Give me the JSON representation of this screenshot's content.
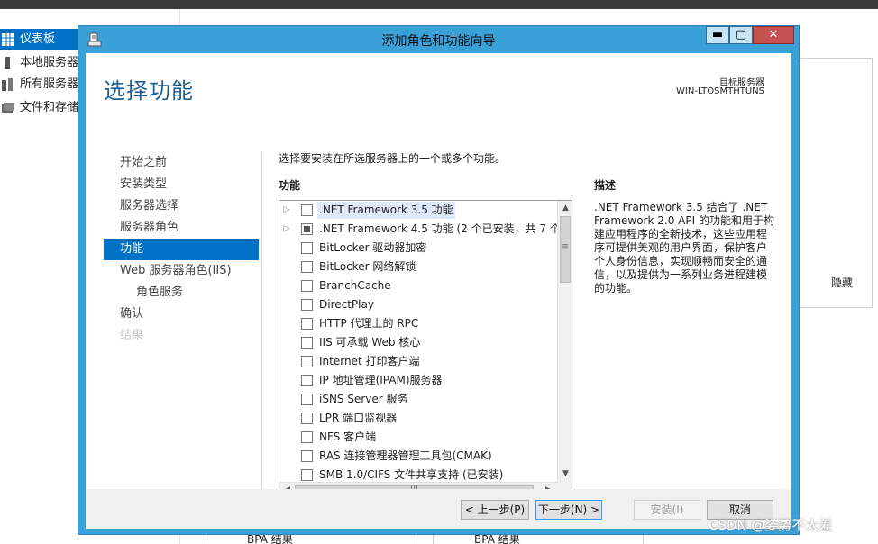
{
  "background": {
    "nav_items": [
      {
        "label": "仪表板",
        "active": true
      },
      {
        "label": "本地服务器"
      },
      {
        "label": "所有服务器"
      },
      {
        "label": "文件和存储"
      }
    ],
    "hide_label": "隐藏",
    "bottom_left": "BPA 结果",
    "bottom_right": "BPA 结果"
  },
  "dialog": {
    "title": "添加角色和功能向导",
    "window_buttons": {
      "minimize": "▬",
      "maximize": "▢",
      "close": "✕"
    },
    "page_title": "选择功能",
    "target_label": "目标服务器",
    "target_name": "WIN-LTOSMTHTUNS",
    "steps": [
      {
        "label": "开始之前"
      },
      {
        "label": "安装类型"
      },
      {
        "label": "服务器选择"
      },
      {
        "label": "服务器角色"
      },
      {
        "label": "功能",
        "active": true
      },
      {
        "label": "Web 服务器角色(IIS)"
      },
      {
        "label": "角色服务",
        "sub": true
      },
      {
        "label": "确认"
      },
      {
        "label": "结果",
        "disabled": true
      }
    ],
    "instruction": "选择要安装在所选服务器上的一个或多个功能。",
    "features_header": "功能",
    "features": [
      {
        "label": ".NET Framework 3.5 功能",
        "expandable": true,
        "state": "unchecked",
        "selected": true
      },
      {
        "label": ".NET Framework 4.5 功能 (2 个已安装，共 7 个)",
        "expandable": true,
        "state": "partial"
      },
      {
        "label": "BitLocker 驱动器加密",
        "state": "unchecked"
      },
      {
        "label": "BitLocker 网络解锁",
        "state": "unchecked"
      },
      {
        "label": "BranchCache",
        "state": "unchecked"
      },
      {
        "label": "DirectPlay",
        "state": "unchecked"
      },
      {
        "label": "HTTP 代理上的 RPC",
        "state": "unchecked"
      },
      {
        "label": "IIS 可承载 Web 核心",
        "state": "unchecked"
      },
      {
        "label": "Internet 打印客户端",
        "state": "unchecked"
      },
      {
        "label": "IP 地址管理(IPAM)服务器",
        "state": "unchecked"
      },
      {
        "label": "iSNS Server 服务",
        "state": "unchecked"
      },
      {
        "label": "LPR 端口监视器",
        "state": "unchecked"
      },
      {
        "label": "NFS 客户端",
        "state": "unchecked"
      },
      {
        "label": "RAS 连接管理器管理工具包(CMAK)",
        "state": "unchecked"
      },
      {
        "label": "SMB 1.0/CIFS 文件共享支持 (已安装)",
        "state": "unchecked"
      }
    ],
    "description_header": "描述",
    "description": ".NET Framework 3.5 结合了 .NET Framework 2.0 API 的功能和用于构建应用程序的全新技术，这些应用程序可提供美观的用户界面，保护客户个人身份信息，实现顺畅而安全的通信，以及提供为一系列业务进程建模的功能。",
    "buttons": {
      "prev": "< 上一步(P)",
      "next": "下一步(N) >",
      "install": "安装(I)",
      "cancel": "取消"
    }
  },
  "watermark": "CSDN @姿势不太差"
}
